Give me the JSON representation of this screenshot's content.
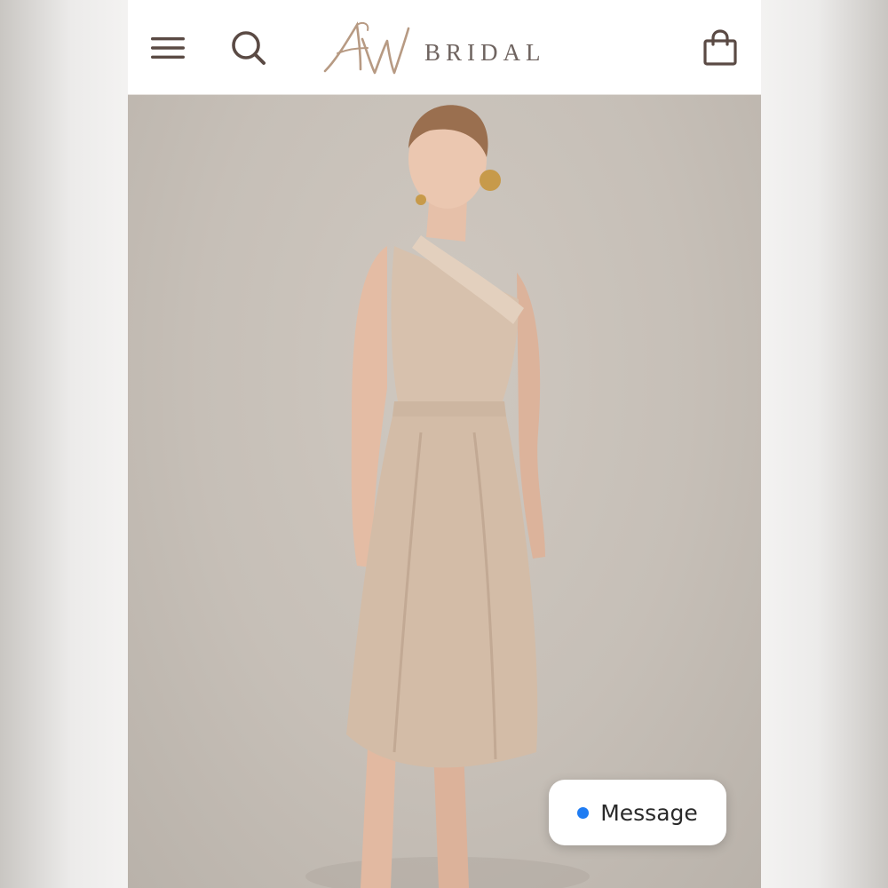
{
  "brand": {
    "monogram": "AW",
    "wordmark": "BRIDAL",
    "accent_color": "#b79a83"
  },
  "nav": {
    "menu_icon": "hamburger-menu-icon",
    "search_icon": "search-icon",
    "bag_icon": "shopping-bag-icon",
    "icon_color": "#5a4a44"
  },
  "hero": {
    "image": "model-wearing-champagne-halter-satin-midi-dress",
    "background_color": "#c9c2ba"
  },
  "chat": {
    "label": "Message",
    "status_color": "#1f7cf3"
  }
}
